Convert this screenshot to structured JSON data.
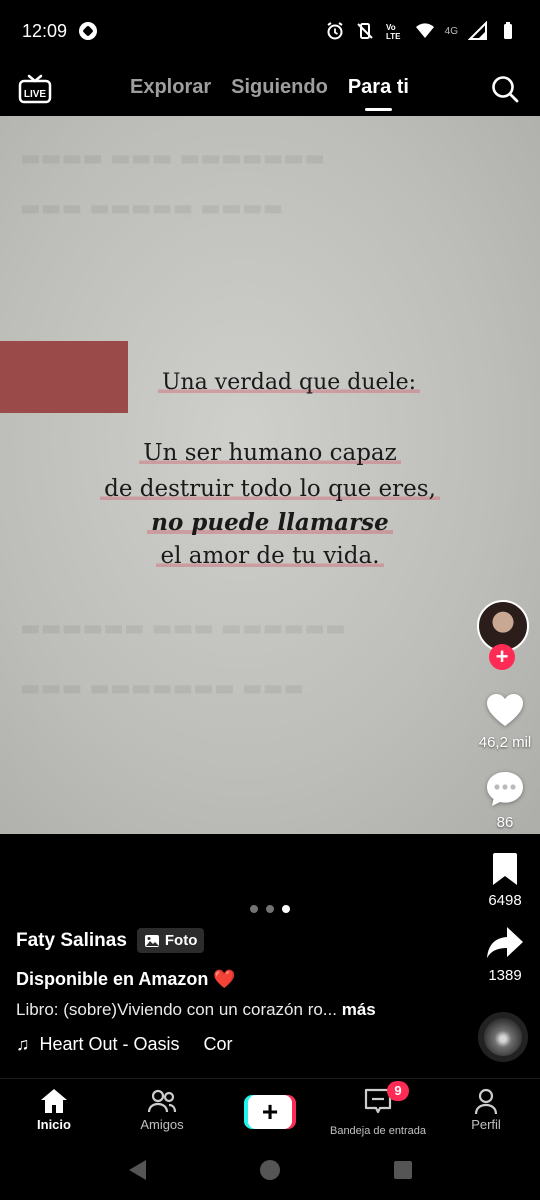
{
  "status_bar": {
    "time": "12:09",
    "network": "4G"
  },
  "top_nav": {
    "live_label": "LIVE",
    "tabs": [
      {
        "label": "Explorar",
        "active": false
      },
      {
        "label": "Siguiendo",
        "active": false
      },
      {
        "label": "Para ti",
        "active": true
      }
    ]
  },
  "photo": {
    "quote_lines": [
      "Una verdad que duele:",
      "Un ser humano capaz",
      "de destruir todo lo que eres,",
      "no puede llamarse",
      "el amor de tu vida."
    ]
  },
  "actions": {
    "likes": "46,2 mil",
    "comments": "86",
    "saves": "6498",
    "shares": "1389"
  },
  "pager": {
    "count": 3,
    "active_index": 2
  },
  "caption": {
    "author": "Faty Salinas",
    "tag": "Foto",
    "headline": "Disponible en Amazon ❤️",
    "description": "Libro: (sobre)Viviendo con un corazón ro...",
    "more": "más",
    "music": "Heart Out - Oasis",
    "music_extra": "Cor"
  },
  "bottom_nav": {
    "home": "Inicio",
    "friends": "Amigos",
    "inbox": "Bandeja de entrada",
    "inbox_badge": "9",
    "profile": "Perfil"
  },
  "colors": {
    "accent": "#fe2c55",
    "cyan": "#25f4ee",
    "highlight": "#cd7882"
  }
}
